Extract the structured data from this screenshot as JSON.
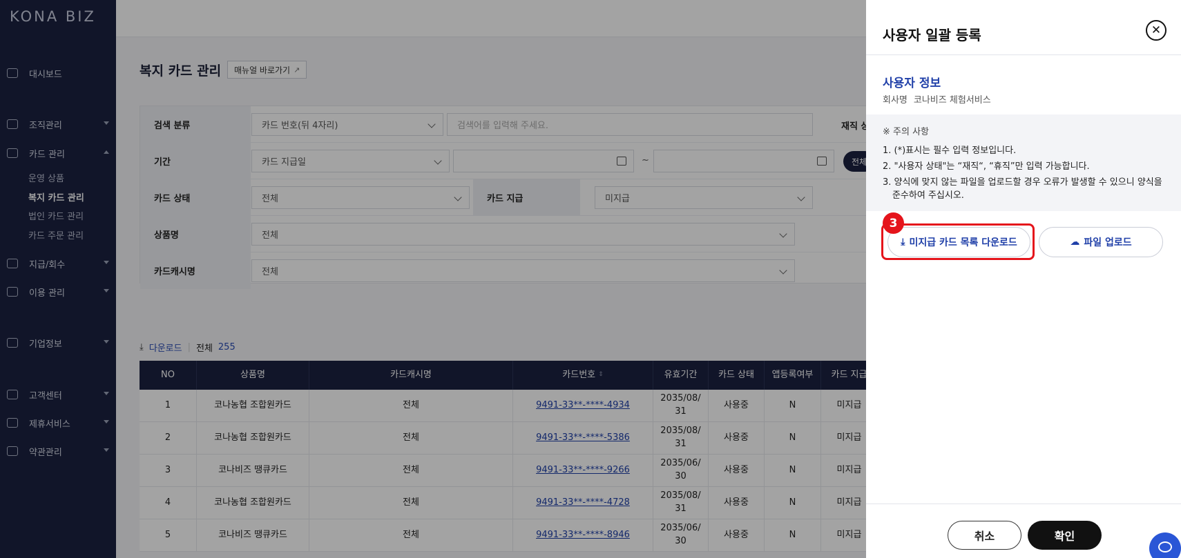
{
  "sidebar": {
    "logo": "KONA BIZ",
    "items": [
      {
        "label": "대시보드"
      },
      {
        "label": "조직관리"
      },
      {
        "label": "카드 관리"
      },
      {
        "label": "지급/회수"
      },
      {
        "label": "이용 관리"
      },
      {
        "label": "기업정보"
      },
      {
        "label": "고객센터"
      },
      {
        "label": "제휴서비스"
      },
      {
        "label": "약관관리"
      }
    ],
    "card_sub_items": [
      {
        "label": "운영 상품"
      },
      {
        "label": "복지 카드 관리"
      },
      {
        "label": "법인 카드 관리"
      },
      {
        "label": "카드 주문 관리"
      }
    ]
  },
  "page": {
    "title": "복지 카드 관리",
    "manual_label": "매뉴얼 바로가기"
  },
  "filters": {
    "search_category_label": "검색 분류",
    "search_category_value": "카드 번호(뒤 4자리)",
    "search_placeholder": "검색어를 입력해 주세요.",
    "employment_label": "재직 상",
    "period_label": "기간",
    "period_type_value": "카드 지급일",
    "period_tilde": "~",
    "period_all_label": "전체",
    "card_status_label": "카드 상태",
    "card_status_value": "전체",
    "card_issue_label": "카드 지급",
    "card_issue_value": "미지급",
    "product_label": "상품명",
    "product_value": "전체",
    "cashname_label": "카드캐시명",
    "cashname_value": "전체"
  },
  "list": {
    "download_label": "다운로드",
    "total_label": "전체",
    "total_count": "255",
    "columns": [
      "NO",
      "상품명",
      "카드캐시명",
      "카드번호",
      "유효기간",
      "카드 상태",
      "앱등록여부",
      "카드 지급"
    ],
    "rows": [
      {
        "no": "1",
        "product": "코나농협 조합원카드",
        "cash": "전체",
        "card": "9491-33**-****-4934",
        "exp1": "2035/08/",
        "exp2": "31",
        "status": "사용중",
        "app": "N",
        "issue": "미지급"
      },
      {
        "no": "2",
        "product": "코나농협 조합원카드",
        "cash": "전체",
        "card": "9491-33**-****-5386",
        "exp1": "2035/08/",
        "exp2": "31",
        "status": "사용중",
        "app": "N",
        "issue": "미지급"
      },
      {
        "no": "3",
        "product": "코나비즈 땡큐카드",
        "cash": "전체",
        "card": "9491-33**-****-9266",
        "exp1": "2035/06/",
        "exp2": "30",
        "status": "사용중",
        "app": "N",
        "issue": "미지급"
      },
      {
        "no": "4",
        "product": "코나농협 조합원카드",
        "cash": "전체",
        "card": "9491-33**-****-4728",
        "exp1": "2035/08/",
        "exp2": "31",
        "status": "사용중",
        "app": "N",
        "issue": "미지급"
      },
      {
        "no": "5",
        "product": "코나비즈 땡큐카드",
        "cash": "전체",
        "card": "9491-33**-****-8946",
        "exp1": "2035/06/",
        "exp2": "30",
        "status": "사용중",
        "app": "N",
        "issue": "미지급"
      }
    ]
  },
  "panel": {
    "title": "사용자 일괄 등록",
    "close_icon": "close-icon",
    "user_info_title": "사용자 정보",
    "company_label": "회사명",
    "company_value": "코나비즈 체험서비스",
    "notice_title": "※ 주의 사항",
    "notices": [
      "1. (*)표시는 필수 입력 정보입니다.",
      "2. \"사용자 상태\"는 “재직“, “휴직”만 입력 가능합니다.",
      "3. 양식에 맞지 않는 파일을 업로드할 경우 오류가 발생할 수 있으니 양식을 준수하여 주십시오."
    ],
    "download_label": "미지급 카드 목록 다운로드",
    "upload_label": "파일 업로드",
    "step_badge": "3",
    "cancel_label": "취소",
    "confirm_label": "확인"
  },
  "colors": {
    "sidebar_bg": "#1b2140",
    "accent_blue": "#1f3fa8",
    "highlight_red": "#e5141b"
  }
}
